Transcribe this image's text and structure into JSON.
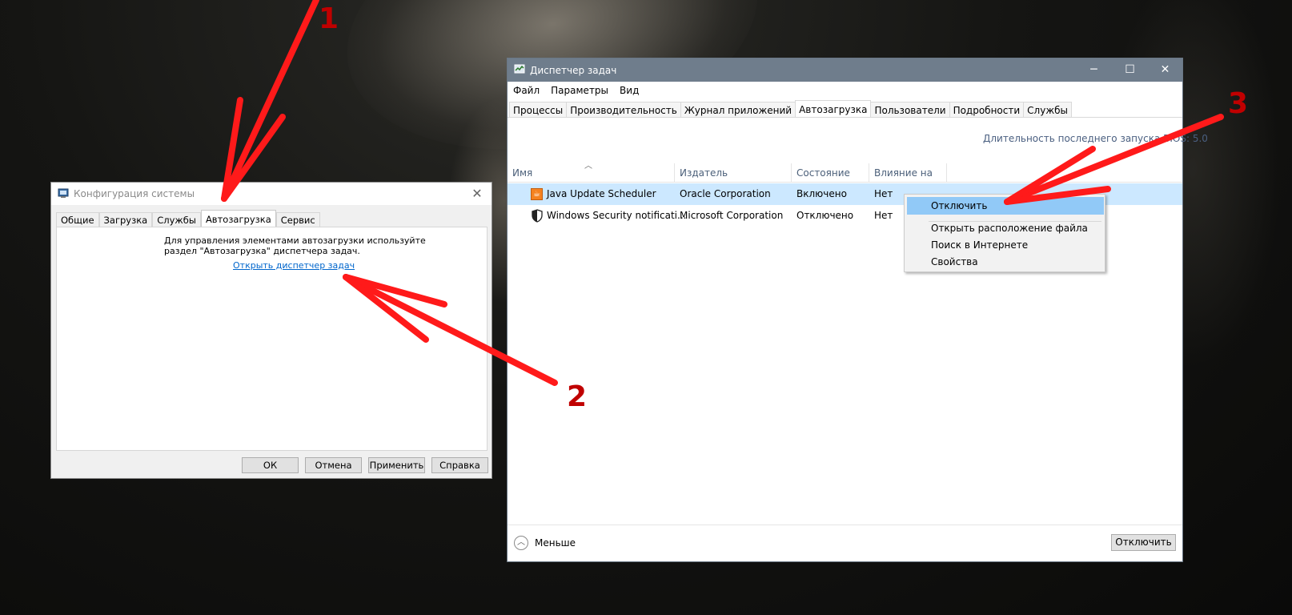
{
  "msconfig": {
    "title": "Конфигурация системы",
    "tabs": [
      "Общие",
      "Загрузка",
      "Службы",
      "Автозагрузка",
      "Сервис"
    ],
    "active_tab": "Автозагрузка",
    "message": "Для управления элементами автозагрузки используйте раздел \"Автозагрузка\" диспетчера задач.",
    "link": "Открыть диспетчер задач",
    "buttons": {
      "ok": "ОК",
      "cancel": "Отмена",
      "apply": "Применить",
      "help": "Справка"
    }
  },
  "taskmgr": {
    "title": "Диспетчер задач",
    "menu": [
      "Файл",
      "Параметры",
      "Вид"
    ],
    "tabs": [
      "Процессы",
      "Производительность",
      "Журнал приложений",
      "Автозагрузка",
      "Пользователи",
      "Подробности",
      "Службы"
    ],
    "active_tab": "Автозагрузка",
    "bios_label": "Длительность последнего запуска BIOS: 5.0",
    "columns": [
      "Имя",
      "Издатель",
      "Состояние",
      "Влияние на за..."
    ],
    "rows": [
      {
        "name": "Java Update Scheduler",
        "publisher": "Oracle Corporation",
        "status": "Включено",
        "impact": "Нет",
        "icon": "java-icon"
      },
      {
        "name": "Windows Security notificati...",
        "publisher": "Microsoft Corporation",
        "status": "Отключено",
        "impact": "Нет",
        "icon": "shield-icon"
      }
    ],
    "footer": {
      "less": "Меньше",
      "disable": "Отключить"
    }
  },
  "context_menu": {
    "items": [
      "Отключить",
      "Открыть расположение файла",
      "Поиск в Интернете",
      "Свойства"
    ]
  },
  "annotations": {
    "n1": "1",
    "n2": "2",
    "n3": "3",
    "color": "#ff0000"
  }
}
